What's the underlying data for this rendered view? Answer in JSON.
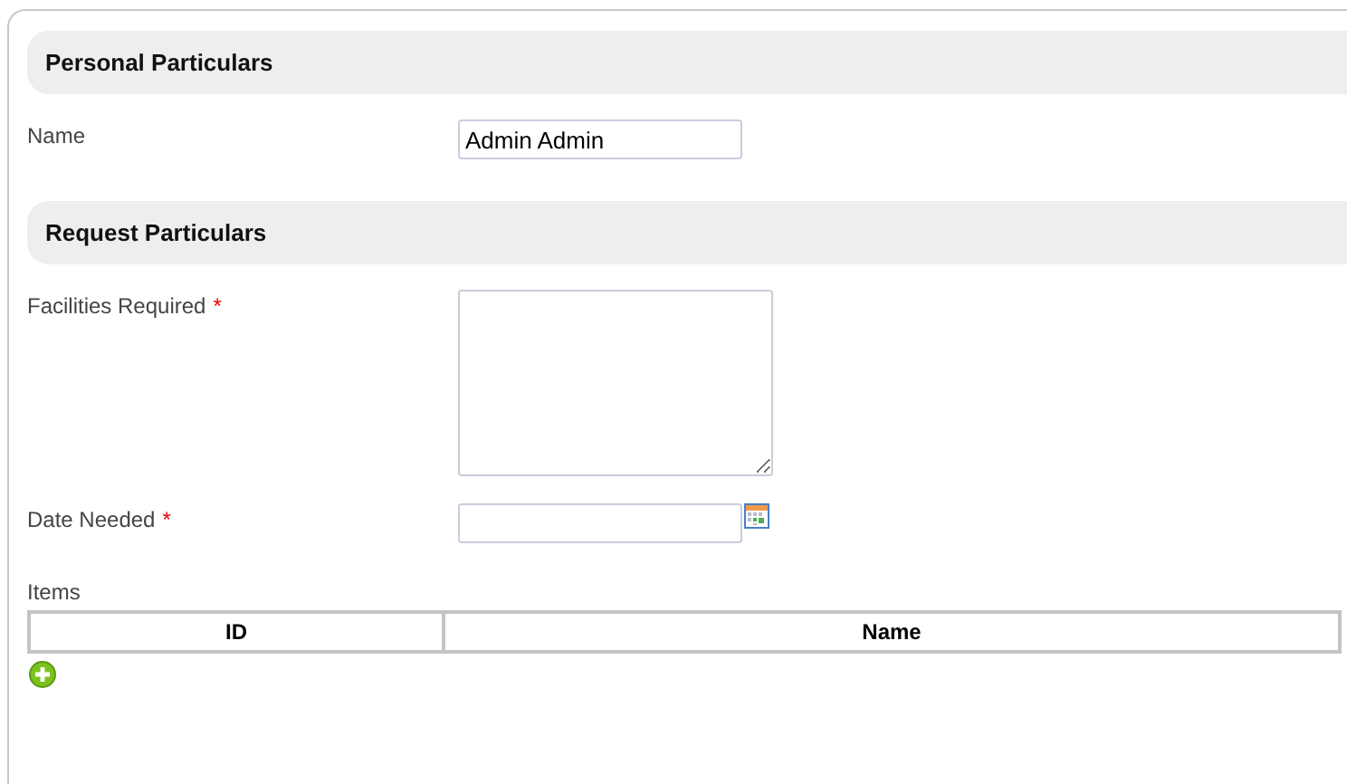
{
  "sections": [
    {
      "title": "Personal Particulars",
      "fields": [
        {
          "kind": "text",
          "label": "Name",
          "value": "Admin Admin"
        }
      ]
    },
    {
      "title": "Request Particulars",
      "fields": [
        {
          "kind": "textarea",
          "label": "Facilities Required",
          "required_mark": "*"
        },
        {
          "kind": "date",
          "label": "Date Needed",
          "required_mark": "*"
        }
      ]
    }
  ],
  "items": {
    "label": "Items",
    "columns": [
      "ID",
      "Name"
    ]
  }
}
